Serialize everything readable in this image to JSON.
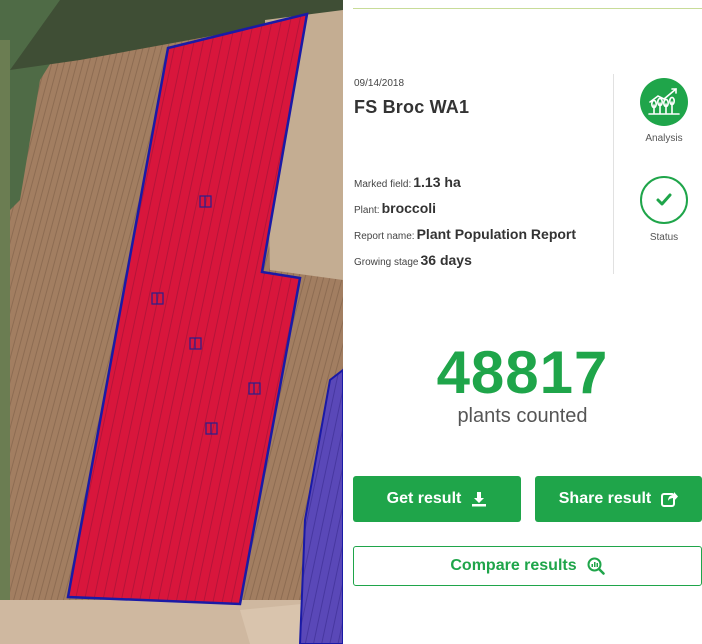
{
  "map": {
    "icons": [
      "field-map",
      "plot-marker"
    ]
  },
  "report": {
    "date": "09/14/2018",
    "title": "FS Broc WA1",
    "marked_field_label": "Marked field:",
    "marked_field_value": "1.13 ha",
    "plant_label": "Plant:",
    "plant_value": "broccoli",
    "report_name_label": "Report name:",
    "report_name_value": "Plant Population Report",
    "growing_stage_label": "Growing stage",
    "growing_stage_value": "36 days"
  },
  "side": {
    "analysis_label": "Analysis",
    "status_label": "Status",
    "analysis_icon": "analysis-chart-icon",
    "status_icon": "checkmark-icon"
  },
  "result": {
    "count": "48817",
    "caption": "plants counted"
  },
  "buttons": {
    "get_result": "Get result",
    "share_result": "Share result",
    "compare_results": "Compare results"
  },
  "colors": {
    "accent": "#1fa54a",
    "field_fill": "#d8163c",
    "field_outline": "#1a1aa6"
  }
}
